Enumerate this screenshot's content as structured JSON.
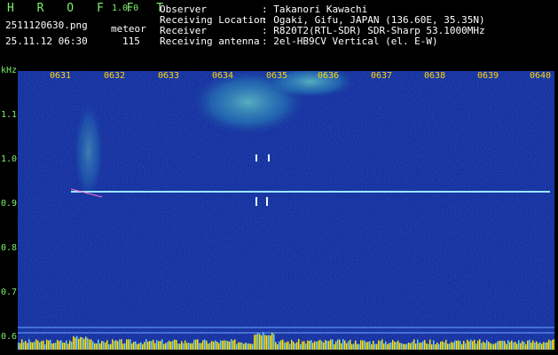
{
  "header": {
    "app_name": "H R O F F T",
    "version": "1.0.0",
    "filename": "2511120630.png",
    "datetime": "25.11.12 06:30",
    "meteor_label": "meteor",
    "meteor_count": "115",
    "info_labels": [
      "Observer",
      "Receiving Location",
      "Receiver",
      "Receiving antenna"
    ],
    "info_values": [
      ": Takanori Kawachi",
      ": Ogaki, Gifu, JAPAN (136.60E, 35.35N)",
      ": R820T2(RTL-SDR) SDR-Sharp 53.1000MHz",
      ": 2el-HB9CV Vertical (el. E-W)"
    ]
  },
  "spectrogram": {
    "y_unit": "kHz",
    "y_ticks": [
      "1.1",
      "1.0",
      "0.9",
      "0.8",
      "0.7",
      "0.6"
    ],
    "x_ticks": [
      "0631",
      "0632",
      "0633",
      "0634",
      "0635",
      "0636",
      "0637",
      "0638",
      "0639",
      "0640"
    ],
    "colors": {
      "background": "#0a1a8a",
      "trace": "#9be8ff",
      "axis_text": "#7cf06a",
      "time_text": "#ffd700",
      "level_bar": "#ffe600"
    }
  }
}
